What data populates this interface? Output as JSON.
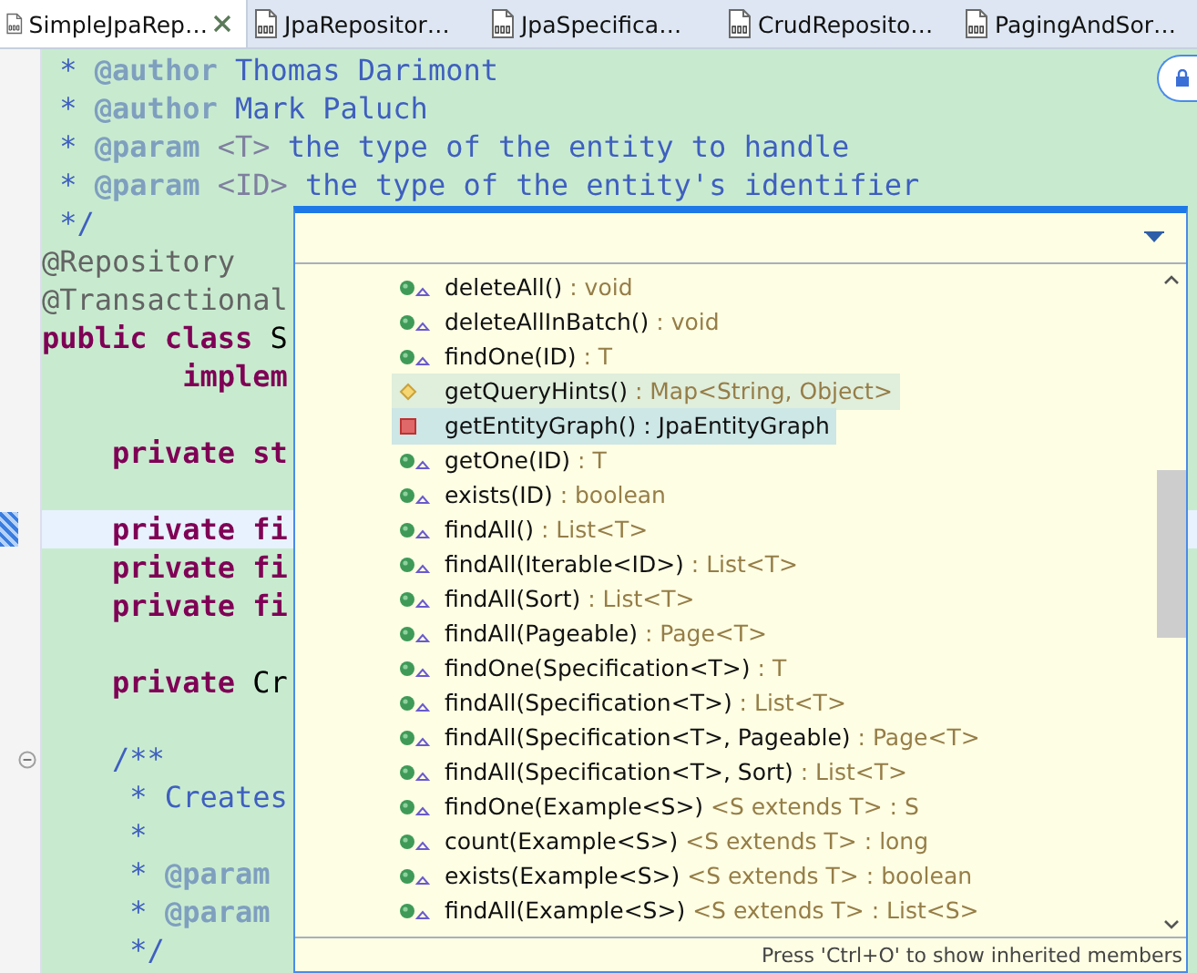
{
  "tabs": [
    {
      "label": "SimpleJpaRep…",
      "selected": true
    },
    {
      "label": "JpaRepositor…",
      "selected": false
    },
    {
      "label": "JpaSpecifica…",
      "selected": false
    },
    {
      "label": "CrudReposito…",
      "selected": false
    },
    {
      "label": "PagingAndSor…",
      "selected": false
    }
  ],
  "editor": {
    "lines": [
      {
        "kind": "code",
        "segments": [
          {
            "kind": "javadoc",
            "text": " * "
          },
          {
            "kind": "tag",
            "text": "@author"
          },
          {
            "kind": "javadoc",
            "text": " Thomas Darimont"
          }
        ]
      },
      {
        "kind": "code",
        "segments": [
          {
            "kind": "javadoc",
            "text": " * "
          },
          {
            "kind": "tag",
            "text": "@author"
          },
          {
            "kind": "javadoc",
            "text": " Mark Paluch"
          }
        ]
      },
      {
        "kind": "code",
        "segments": [
          {
            "kind": "javadoc",
            "text": " * "
          },
          {
            "kind": "tag",
            "text": "@param"
          },
          {
            "kind": "tag-light",
            "text": " <T>"
          },
          {
            "kind": "javadoc",
            "text": " the type of the entity to handle"
          }
        ]
      },
      {
        "kind": "code",
        "segments": [
          {
            "kind": "javadoc",
            "text": " * "
          },
          {
            "kind": "tag",
            "text": "@param"
          },
          {
            "kind": "tag-light",
            "text": " <ID>"
          },
          {
            "kind": "javadoc",
            "text": " the type of the entity's identifier"
          }
        ]
      },
      {
        "kind": "code",
        "segments": [
          {
            "kind": "javadoc",
            "text": " */"
          }
        ]
      },
      {
        "kind": "code",
        "segments": [
          {
            "kind": "annotation",
            "text": "@Repository"
          }
        ]
      },
      {
        "kind": "code",
        "segments": [
          {
            "kind": "annotation",
            "text": "@Transactional"
          }
        ]
      },
      {
        "kind": "code",
        "segments": [
          {
            "kind": "keyword",
            "text": "public class"
          },
          {
            "kind": "plain",
            "text": " S"
          }
        ]
      },
      {
        "kind": "code",
        "segments": [
          {
            "kind": "keyword",
            "text": "        implem"
          }
        ]
      },
      {
        "kind": "blank"
      },
      {
        "kind": "code",
        "segments": [
          {
            "kind": "keyword",
            "text": "    private st"
          }
        ]
      },
      {
        "kind": "blank"
      },
      {
        "kind": "code",
        "current": true,
        "segments": [
          {
            "kind": "keyword",
            "text": "    private fi"
          }
        ]
      },
      {
        "kind": "code",
        "segments": [
          {
            "kind": "keyword",
            "text": "    private fi"
          }
        ]
      },
      {
        "kind": "code",
        "segments": [
          {
            "kind": "keyword",
            "text": "    private fi"
          }
        ]
      },
      {
        "kind": "blank"
      },
      {
        "kind": "code",
        "segments": [
          {
            "kind": "keyword",
            "text": "    private"
          },
          {
            "kind": "plain",
            "text": " Cr"
          }
        ]
      },
      {
        "kind": "blank"
      },
      {
        "kind": "code",
        "fold": true,
        "segments": [
          {
            "kind": "javadoc",
            "text": "    /**"
          }
        ]
      },
      {
        "kind": "code",
        "segments": [
          {
            "kind": "javadoc",
            "text": "     * Creates"
          }
        ]
      },
      {
        "kind": "code",
        "segments": [
          {
            "kind": "javadoc",
            "text": "     *"
          }
        ]
      },
      {
        "kind": "code",
        "segments": [
          {
            "kind": "javadoc",
            "text": "     * "
          },
          {
            "kind": "tag",
            "text": "@param"
          }
        ]
      },
      {
        "kind": "code",
        "segments": [
          {
            "kind": "javadoc",
            "text": "     * "
          },
          {
            "kind": "tag",
            "text": "@param"
          }
        ]
      },
      {
        "kind": "code",
        "segments": [
          {
            "kind": "javadoc",
            "text": "     */"
          }
        ]
      }
    ]
  },
  "outline": {
    "items": [
      {
        "kind": "public",
        "name": "deleteAll()",
        "detail": " : void",
        "hovered": false,
        "selected": false
      },
      {
        "kind": "public",
        "name": "deleteAllInBatch()",
        "detail": " : void",
        "hovered": false,
        "selected": false
      },
      {
        "kind": "public",
        "name": "findOne(ID)",
        "detail": " : T",
        "hovered": false,
        "selected": false
      },
      {
        "kind": "default",
        "name": "getQueryHints()",
        "detail": " : Map<String, Object>",
        "hovered": true,
        "selected": false
      },
      {
        "kind": "private",
        "name": "getEntityGraph()",
        "detail": " : JpaEntityGraph",
        "hovered": false,
        "selected": true
      },
      {
        "kind": "public",
        "name": "getOne(ID)",
        "detail": " : T",
        "hovered": false,
        "selected": false
      },
      {
        "kind": "public",
        "name": "exists(ID)",
        "detail": " : boolean",
        "hovered": false,
        "selected": false
      },
      {
        "kind": "public",
        "name": "findAll()",
        "detail": " : List<T>",
        "hovered": false,
        "selected": false
      },
      {
        "kind": "public",
        "name": "findAll(Iterable<ID>)",
        "detail": " : List<T>",
        "hovered": false,
        "selected": false
      },
      {
        "kind": "public",
        "name": "findAll(Sort)",
        "detail": " : List<T>",
        "hovered": false,
        "selected": false
      },
      {
        "kind": "public",
        "name": "findAll(Pageable)",
        "detail": " : Page<T>",
        "hovered": false,
        "selected": false
      },
      {
        "kind": "public",
        "name": "findOne(Specification<T>)",
        "detail": " : T",
        "hovered": false,
        "selected": false
      },
      {
        "kind": "public",
        "name": "findAll(Specification<T>)",
        "detail": " : List<T>",
        "hovered": false,
        "selected": false
      },
      {
        "kind": "public",
        "name": "findAll(Specification<T>, Pageable)",
        "detail": " : Page<T>",
        "hovered": false,
        "selected": false
      },
      {
        "kind": "public",
        "name": "findAll(Specification<T>, Sort)",
        "detail": " : List<T>",
        "hovered": false,
        "selected": false
      },
      {
        "kind": "public",
        "name": "findOne(Example<S>)",
        "detail": " <S extends T> : S",
        "hovered": false,
        "selected": false
      },
      {
        "kind": "public",
        "name": "count(Example<S>)",
        "detail": " <S extends T> : long",
        "hovered": false,
        "selected": false
      },
      {
        "kind": "public",
        "name": "exists(Example<S>)",
        "detail": " <S extends T> : boolean",
        "hovered": false,
        "selected": false
      },
      {
        "kind": "public",
        "name": "findAll(Example<S>)",
        "detail": " <S extends T> : List<S>",
        "hovered": false,
        "selected": false
      }
    ],
    "hint": "Press 'Ctrl+O' to show inherited members"
  }
}
